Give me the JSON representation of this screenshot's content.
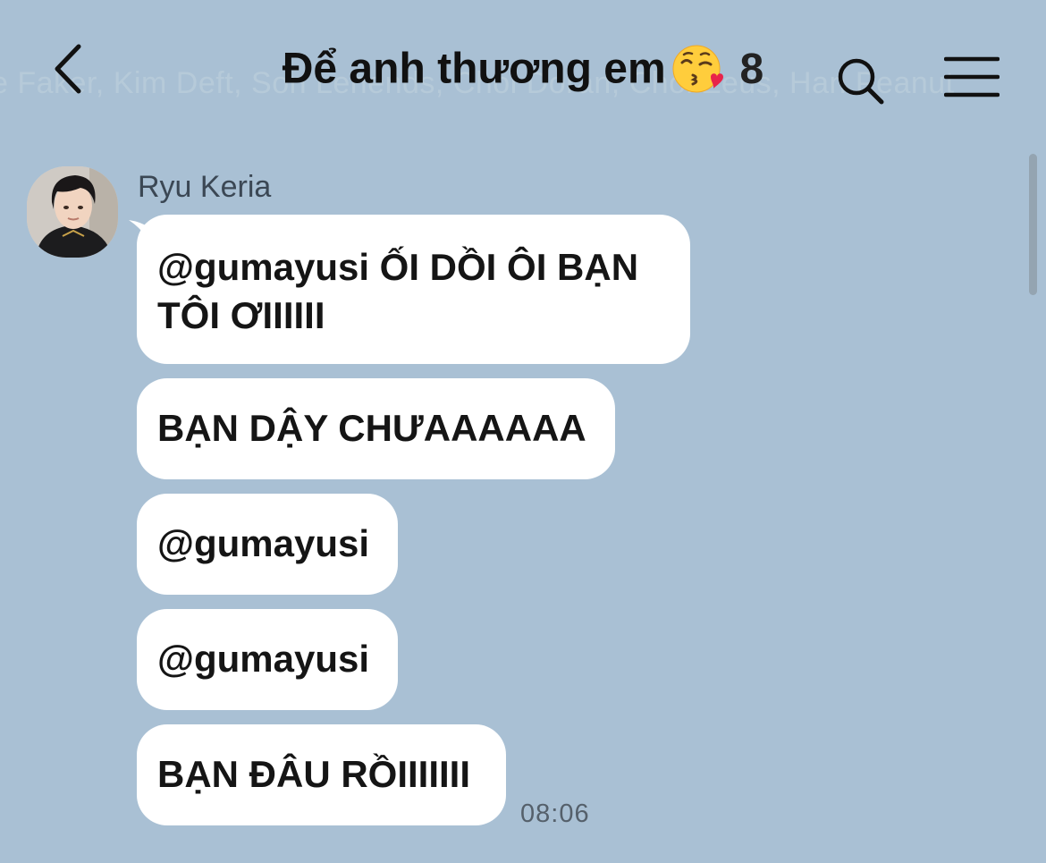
{
  "header": {
    "subtitle": "e Faker, Kim Deft, Son Lehends, Choi Doran, Choi Zeus, Han Peanut",
    "title": "Để anh thương em",
    "title_emoji": "kissing-face-with-heart-emoji",
    "member_count": "8",
    "icons": {
      "back": "chevron-left-icon",
      "search": "search-icon",
      "menu": "hamburger-menu-icon"
    }
  },
  "chat": {
    "sender": {
      "name": "Ryu Keria",
      "avatar": "avatar-photo"
    },
    "messages": [
      {
        "text_line1": "@gumayusi ỐI DỒI ÔI BẠN",
        "text_line2": "TÔI ƠIIIIII"
      },
      {
        "text": "BẠN DẬY CHƯAAAAAA"
      },
      {
        "text": "@gumayusi"
      },
      {
        "text": "@gumayusi"
      },
      {
        "text": "BẠN ĐÂU RỒIIIIIII"
      }
    ],
    "timestamp": "08:06"
  },
  "colors": {
    "background": "#a9c0d4",
    "bubble": "#ffffff",
    "text": "#151515"
  }
}
